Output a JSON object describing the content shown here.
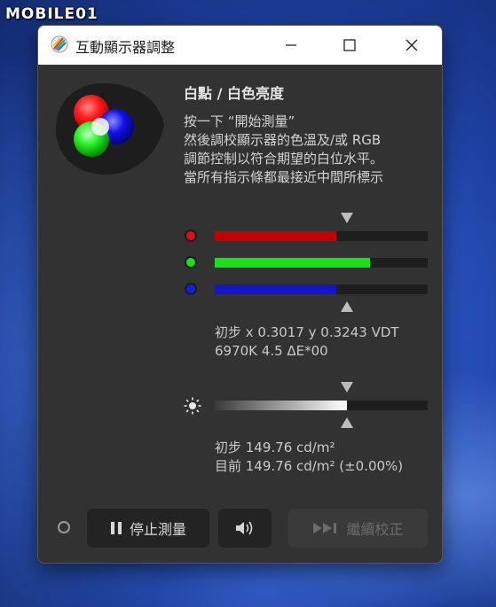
{
  "watermark": {
    "text": "MOBILE01"
  },
  "window": {
    "title": "互動顯示器調整",
    "controls": {
      "minimize": "minimize-icon",
      "maximize": "maximize-icon",
      "close": "close-icon"
    }
  },
  "section": {
    "heading": "白點 / 白色亮度",
    "instructions": [
      "按一下 “開始測量”",
      "然後調校顯示器的色溫及/或 RGB",
      "調節控制以符合期望的白位水平。",
      "當所有指示條都最接近中間所標示"
    ]
  },
  "rgb_bars": [
    {
      "channel": "red",
      "color": "#e01010",
      "fill_color": "#c40000",
      "level": 0.57
    },
    {
      "channel": "green",
      "color": "#19e019",
      "fill_color": "#19e019",
      "level": 0.73
    },
    {
      "channel": "blue",
      "color": "#1020e0",
      "fill_color": "#1515c8",
      "level": 0.57
    }
  ],
  "rgb_target": 0.62,
  "whitepoint": {
    "line1": "初步 x 0.3017 y 0.3243 VDT",
    "line2": "6970K 4.5 ΔE*00"
  },
  "brightness": {
    "level": 0.62,
    "target": 0.62,
    "line1": "初步 149.76 cd/m²",
    "line2": "目前 149.76 cd/m² (±0.00%)"
  },
  "buttons": {
    "stop_label": "停止測量",
    "continue_label": "繼續校正",
    "sound_icon": "speaker-icon"
  },
  "colors": {
    "window_bg": "#323232",
    "titlebar_bg": "#ffffff"
  }
}
